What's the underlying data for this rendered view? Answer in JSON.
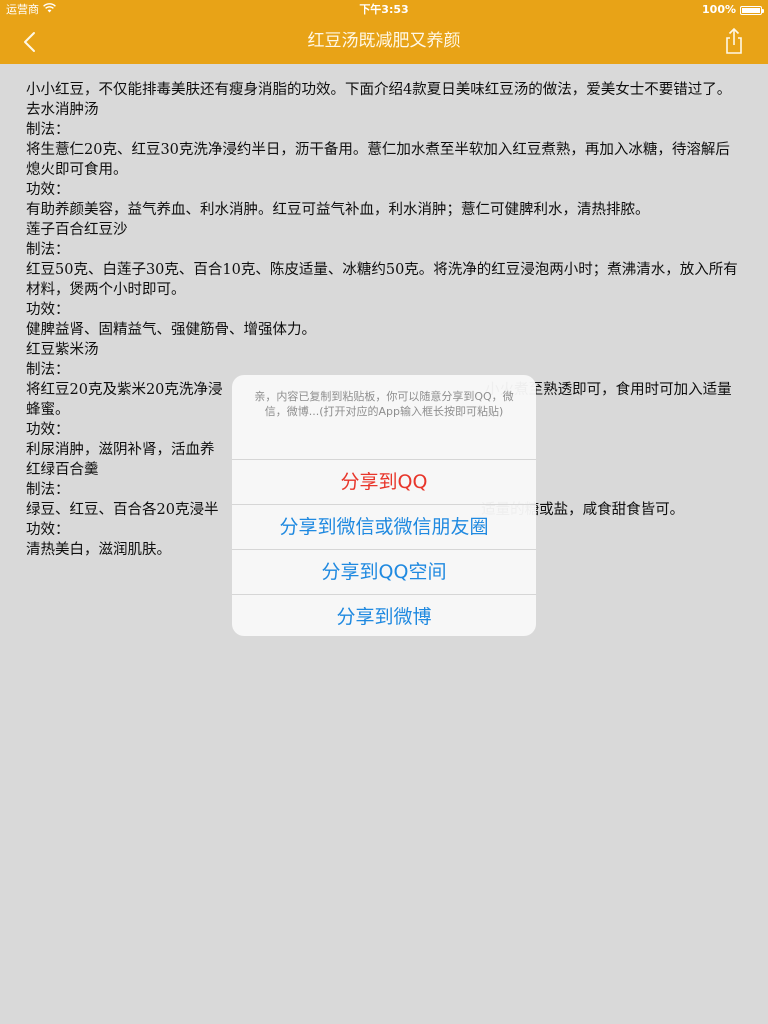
{
  "status_bar": {
    "carrier": "运营商",
    "time": "下午3:53",
    "battery": "100%",
    "battery_level": 1.0
  },
  "nav": {
    "title": "红豆汤既减肥又养颜",
    "back_icon": "chevron-left-icon",
    "share_icon": "share-icon"
  },
  "article": {
    "paragraphs": [
      "小小红豆，不仅能排毒美肤还有瘦身消脂的功效。下面介绍4款夏日美味红豆汤的做法，爱美女士不要错过了。",
      "去水消肿汤",
      "制法：",
      "将生薏仁20克、红豆30克洗净浸约半日，沥干备用。薏仁加水煮至半软加入红豆煮熟，再加入冰糖，待溶解后熄火即可食用。",
      "功效：",
      "有助养颜美容，益气养血、利水消肿。红豆可益气补血，利水消肿；薏仁可健脾利水，清热排脓。",
      "莲子百合红豆沙",
      "制法：",
      "红豆50克、白莲子30克、百合10克、陈皮适量、冰糖约50克。将洗净的红豆浸泡两小时；煮沸清水，放入所有材料，煲两个小时即可。",
      "功效：",
      "健脾益肾、固精益气、强健筋骨、增强体力。",
      "红豆紫米汤",
      "制法：",
      "将红豆20克及紫米20克洗净浸                                                         小火煮至熟透即可，食用时可加入适量蜂蜜。",
      "功效：",
      "利尿消肿，滋阴补肾，活血养",
      "红绿百合羹",
      "制法：",
      "绿豆、红豆、百合各20克浸半                                                         适量的糖或盐，咸食甜食皆可。",
      "功效：",
      "清热美白，滋润肌肤。"
    ]
  },
  "share_sheet": {
    "message": "亲，内容已复制到粘贴板，你可以随意分享到QQ，微信，微博...(打开对应的App输入框长按即可粘贴)",
    "buttons": [
      {
        "label": "分享到QQ",
        "style": "destructive"
      },
      {
        "label": "分享到微信或微信朋友圈",
        "style": "default"
      },
      {
        "label": "分享到QQ空间",
        "style": "default"
      },
      {
        "label": "分享到微博",
        "style": "default"
      }
    ]
  },
  "colors": {
    "bar": "#e8a317",
    "button_text": "#1f89e0",
    "destructive_text": "#e8352a"
  }
}
